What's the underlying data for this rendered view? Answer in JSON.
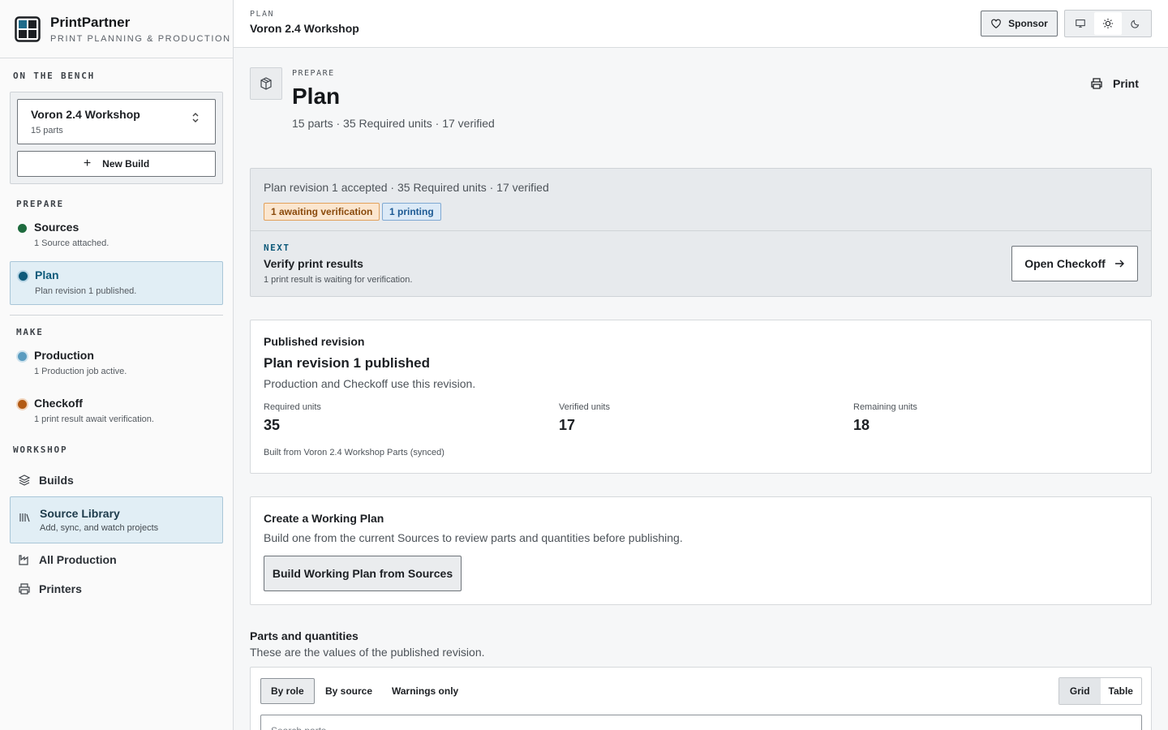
{
  "brand": {
    "name": "PrintPartner",
    "tagline": "PRINT PLANNING & PRODUCTION"
  },
  "bench": {
    "label": "ON THE BENCH",
    "build_name": "Voron 2.4 Workshop",
    "build_parts": "15 parts",
    "new_build_label": "New Build"
  },
  "nav": {
    "prepare_label": "PREPARE",
    "make_label": "MAKE",
    "workshop_label": "WORKSHOP",
    "steps": [
      {
        "title": "Sources",
        "desc": "1 Source attached.",
        "color": "#1e6b3e"
      },
      {
        "title": "Plan",
        "desc": "Plan revision 1 published.",
        "color": "#0e5a7a"
      },
      {
        "title": "Production",
        "desc": "1 Production job active.",
        "color": "#5a9cc0"
      },
      {
        "title": "Checkoff",
        "desc": "1 print result await verification.",
        "color": "#b25a14"
      }
    ],
    "workshop": [
      {
        "label": "Builds",
        "icon": "layers-icon"
      },
      {
        "label": "Source Library",
        "sub": "Add, sync, and watch projects",
        "icon": "library-icon"
      },
      {
        "label": "All Production",
        "icon": "factory-icon"
      },
      {
        "label": "Printers",
        "icon": "printer-icon"
      }
    ]
  },
  "topbar": {
    "crumb_label": "PLAN",
    "crumb_title": "Voron 2.4 Workshop",
    "sponsor_label": "Sponsor"
  },
  "page": {
    "eyebrow": "PREPARE",
    "title": "Plan",
    "meta": "15 parts · 35 Required units · 17 verified",
    "print_label": "Print"
  },
  "status": {
    "line": "Plan revision 1 accepted · 35 Required units · 17 verified",
    "badge_warn": "1 awaiting verification",
    "badge_info": "1 printing",
    "next_label": "NEXT",
    "next_title": "Verify print results",
    "next_desc": "1 print result is waiting for verification.",
    "action_label": "Open Checkoff"
  },
  "published": {
    "heading": "Published revision",
    "title": "Plan revision 1 published",
    "desc": "Production and Checkoff use this revision.",
    "stats": [
      {
        "label": "Required units",
        "value": "35"
      },
      {
        "label": "Verified units",
        "value": "17"
      },
      {
        "label": "Remaining units",
        "value": "18"
      }
    ],
    "built_from": "Built from Voron 2.4 Workshop Parts (synced)"
  },
  "working": {
    "heading": "Create a Working Plan",
    "desc": "Build one from the current Sources to review parts and quantities before publishing.",
    "button": "Build Working Plan from Sources"
  },
  "parts": {
    "heading": "Parts and quantities",
    "desc": "These are the values of the published revision.",
    "tabs": [
      "By role",
      "By source",
      "Warnings only"
    ],
    "views": [
      "Grid",
      "Table"
    ],
    "search_placeholder": "Search parts"
  }
}
